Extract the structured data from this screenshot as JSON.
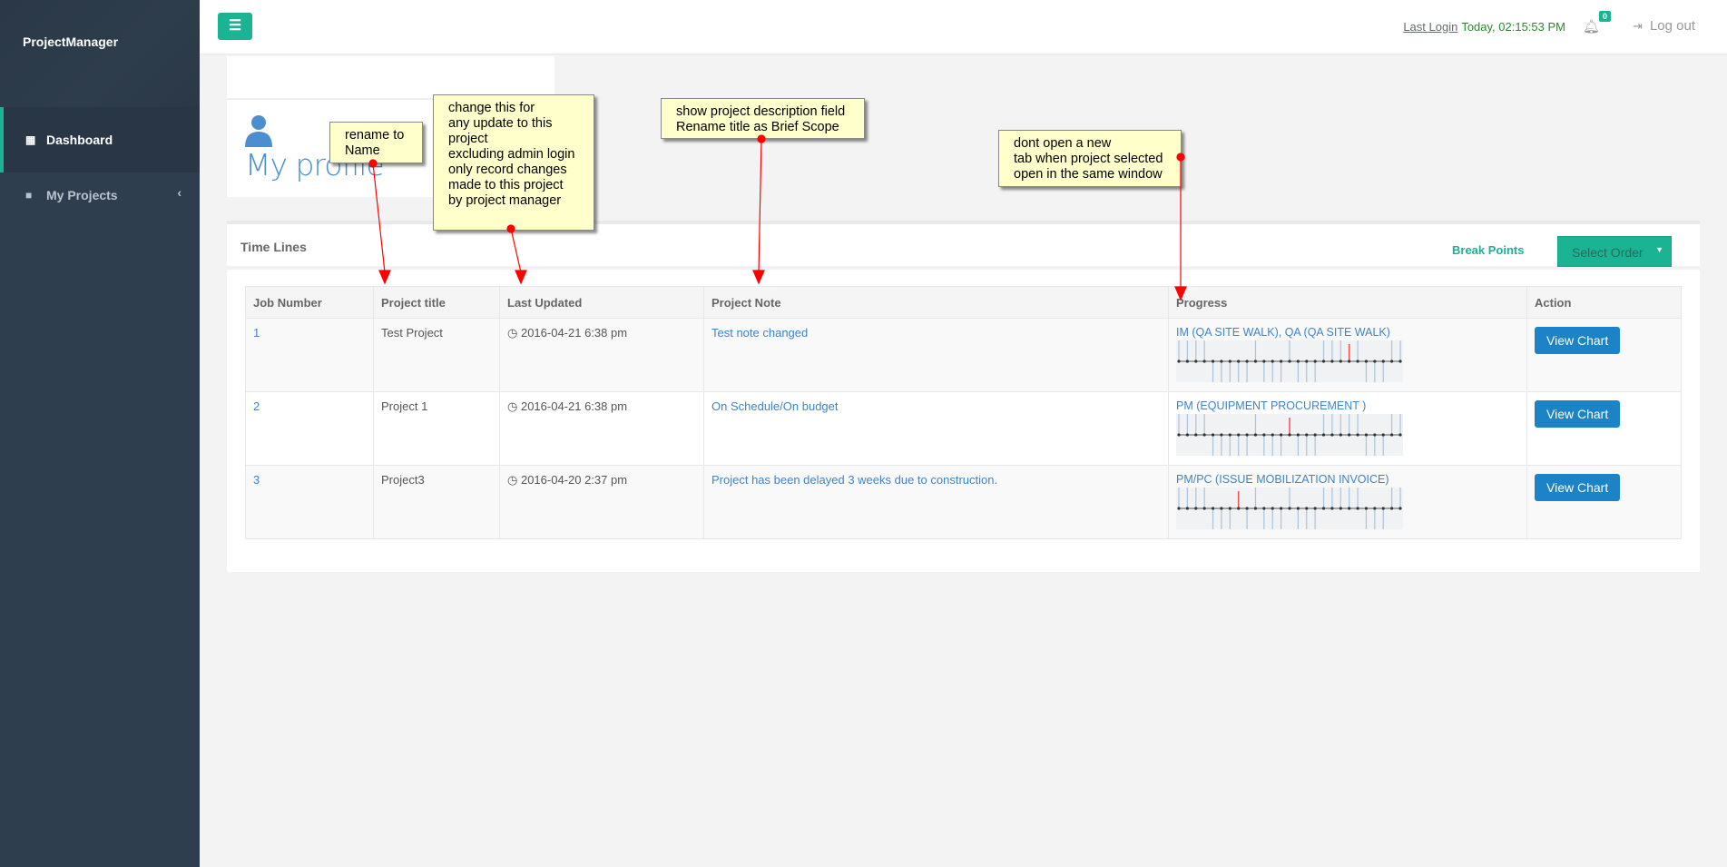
{
  "colors": {
    "accent": "#1ab394",
    "sidebar": "#2f3e4e",
    "link": "#3f84c8",
    "button": "#1c84c6",
    "annotation": "#ffffcc",
    "arrow": "#ff0000"
  },
  "sidebar": {
    "brand": "ProjectManager",
    "items": [
      {
        "label": "Dashboard",
        "icon": "th-large-icon",
        "active": true
      },
      {
        "label": "My Projects",
        "icon": "folder-icon"
      }
    ]
  },
  "header": {
    "menu_icon": "bars-icon",
    "last_login_label": "Last Login",
    "last_login_value": "Today, 02:15:53 PM",
    "notifications": "0",
    "logout": "Log out"
  },
  "profile": {
    "title": "My profile"
  },
  "timelines": {
    "title": "Time Lines",
    "break_points": "Break Points",
    "select_order": "Select Order",
    "columns": [
      "Job Number",
      "Project title",
      "Last Updated",
      "Project Note",
      "Progress",
      "Action"
    ],
    "rows": [
      {
        "job": "1",
        "title": "Test Project",
        "updated": "2016-04-21 6:38 pm",
        "note": "Test note changed",
        "progress": "IM (QA SITE WALK), QA (QA SITE WALK)",
        "current_step": 20,
        "action": "View Chart"
      },
      {
        "job": "2",
        "title": "Project 1",
        "updated": "2016-04-21 6:38 pm",
        "note": "On Schedule/On budget",
        "progress": "PM (EQUIPMENT PROCUREMENT )",
        "current_step": 13,
        "action": "View Chart"
      },
      {
        "job": "3",
        "title": "Project3",
        "updated": "2016-04-20 2:37 pm",
        "note": "Project has been delayed 3 weeks due to construction.",
        "progress": "PM/PC (ISSUE MOBILIZATION INVOICE)",
        "current_step": 7,
        "action": "View Chart"
      }
    ],
    "timeline_steps": 27,
    "steps_up": [
      0,
      1,
      2,
      3,
      9,
      13,
      17,
      18,
      19,
      20,
      21,
      25,
      26
    ]
  },
  "annotations": [
    {
      "text": "rename to\nName"
    },
    {
      "text": "change this for\nany update to this\nproject\nexcluding admin login\nonly record changes\nmade to this project\nby project manager"
    },
    {
      "text": "show project description field\nRename title as Brief Scope"
    },
    {
      "text": "dont open a new\ntab when project selected\nopen in the same window"
    }
  ]
}
